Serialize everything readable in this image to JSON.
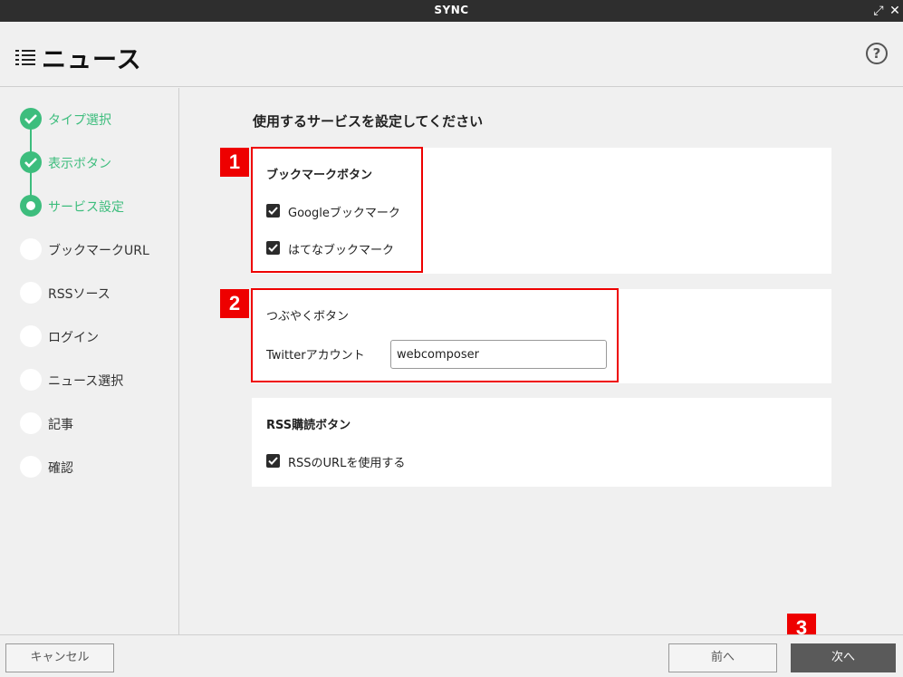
{
  "window": {
    "title": "SYNC",
    "expand_symbol": "⤢",
    "close_symbol": "✕"
  },
  "header": {
    "title": "ニュース",
    "icon": "list-icon",
    "help_symbol": "?"
  },
  "sidebar": {
    "steps": [
      {
        "label": "タイプ選択",
        "state": "done"
      },
      {
        "label": "表示ボタン",
        "state": "done"
      },
      {
        "label": "サービス設定",
        "state": "current"
      },
      {
        "label": "ブックマークURL",
        "state": "pending"
      },
      {
        "label": "RSSソース",
        "state": "pending"
      },
      {
        "label": "ログイン",
        "state": "pending"
      },
      {
        "label": "ニュース選択",
        "state": "pending"
      },
      {
        "label": "記事",
        "state": "pending"
      },
      {
        "label": "確認",
        "state": "pending"
      }
    ],
    "accent_color": "#3dbd7d"
  },
  "main": {
    "heading": "使用するサービスを設定してください",
    "bookmark": {
      "title": "ブックマークボタン",
      "options": [
        {
          "label": "Googleブックマーク",
          "checked": true
        },
        {
          "label": "はてなブックマーク",
          "checked": true
        }
      ]
    },
    "tweet": {
      "title": "つぶやくボタン",
      "field_label": "Twitterアカウント",
      "field_value": "webcomposer"
    },
    "rss": {
      "title": "RSS購読ボタン",
      "options": [
        {
          "label": "RSSのURLを使用する",
          "checked": true
        }
      ]
    }
  },
  "callouts": [
    "1",
    "2",
    "3"
  ],
  "callout_color": "#ee0000",
  "footer": {
    "cancel_label": "キャンセル",
    "prev_label": "前へ",
    "next_label": "次へ"
  }
}
